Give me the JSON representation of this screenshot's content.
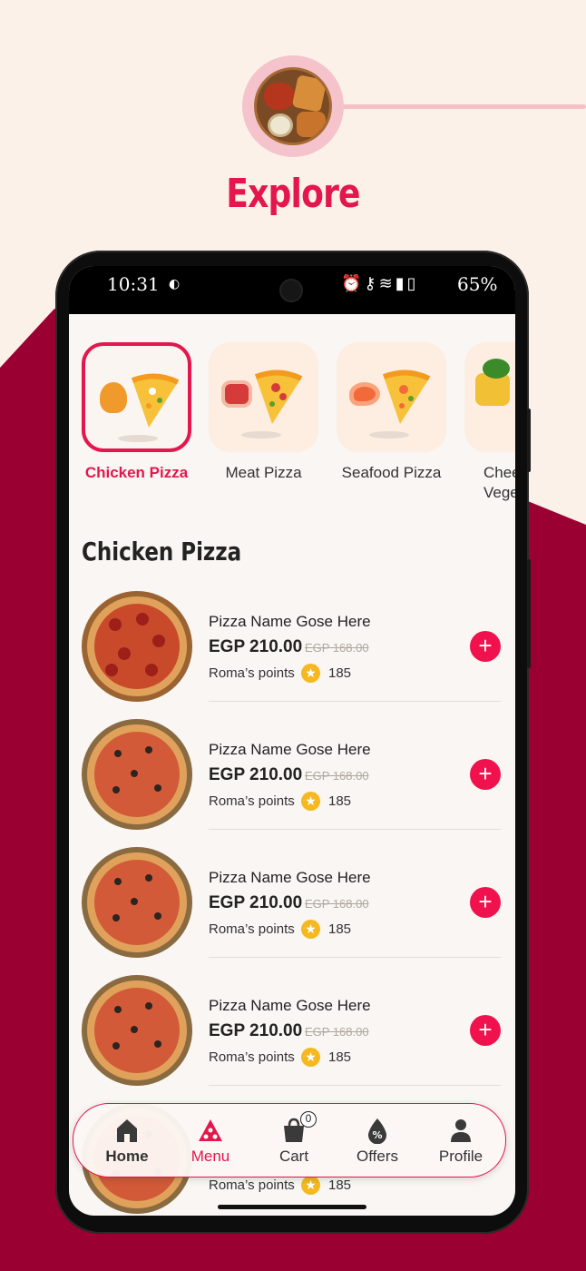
{
  "hero": {
    "title": "Explore"
  },
  "status_bar": {
    "time": "10:31",
    "battery": "65%",
    "icons": [
      "drop-icon",
      "alarm-icon",
      "key-icon",
      "wifi-icon",
      "signal-icon",
      "battery-icon"
    ]
  },
  "categories": [
    {
      "label": "Chicken Pizza",
      "active": true,
      "icon": "chicken-leg-icon"
    },
    {
      "label": "Meat Pizza",
      "active": false,
      "icon": "steak-icon"
    },
    {
      "label": "Seafood Pizza",
      "active": false,
      "icon": "shrimp-icon"
    },
    {
      "label": "Chee\nVege",
      "active": false,
      "icon": "cheese-broccoli-icon"
    }
  ],
  "section_title": "Chicken Pizza",
  "items": [
    {
      "name": "Pizza Name Gose Here",
      "price": "EGP 210.00",
      "old_price": "EGP 168.00",
      "points_label": "Roma’s points",
      "points": "185"
    },
    {
      "name": "Pizza Name Gose Here",
      "price": "EGP 210.00",
      "old_price": "EGP 168.00",
      "points_label": "Roma’s points",
      "points": "185"
    },
    {
      "name": "Pizza Name Gose Here",
      "price": "EGP 210.00",
      "old_price": "EGP 168.00",
      "points_label": "Roma’s points",
      "points": "185"
    },
    {
      "name": "Pizza Name Gose Here",
      "price": "EGP 210.00",
      "old_price": "EGP 168.00",
      "points_label": "Roma’s points",
      "points": "185"
    },
    {
      "name": "",
      "price": "",
      "old_price": "",
      "points_label": "Roma’s points",
      "points": "185"
    }
  ],
  "bottom_nav": {
    "items": [
      {
        "label": "Home",
        "icon": "home-icon"
      },
      {
        "label": "Menu",
        "icon": "pizza-slice-icon",
        "active": true
      },
      {
        "label": "Cart",
        "icon": "cart-icon",
        "badge": "0"
      },
      {
        "label": "Offers",
        "icon": "discount-icon"
      },
      {
        "label": "Profile",
        "icon": "user-icon"
      }
    ]
  },
  "colors": {
    "accent": "#e3174d",
    "maroon": "#9b0032",
    "cream": "#fcf1e9",
    "star": "#f5b81f"
  }
}
